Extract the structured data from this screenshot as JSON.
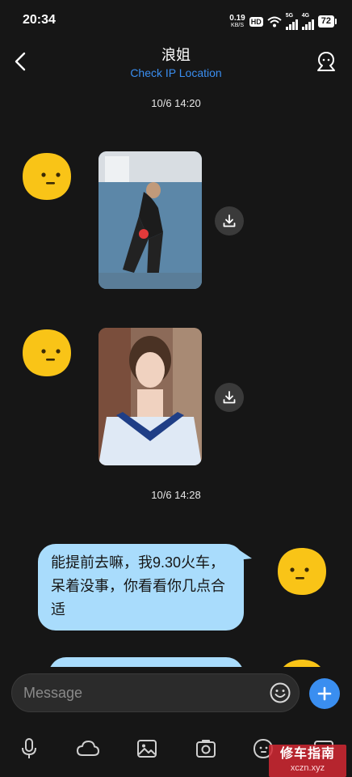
{
  "status": {
    "time": "20:34",
    "net_speed": "0.19",
    "net_unit": "KB/S",
    "hd": "HD",
    "sig1_label": "5G",
    "sig2_label": "4G",
    "battery": "72"
  },
  "header": {
    "title": "浪姐",
    "subtitle": "Check IP Location"
  },
  "messages": {
    "timestamp_1": "10/6 14:20",
    "timestamp_2": "10/6 14:28",
    "outgoing_text": "能提前去嘛，我9.30火车，呆着没事，你看看你几点合适"
  },
  "composer": {
    "placeholder": "Message"
  },
  "watermark": {
    "main": "修车指南",
    "sub": "xczn.xyz"
  },
  "colors": {
    "accent": "#3a8ef0",
    "bubble": "#a9dcfc",
    "avatar": "#f9c417",
    "background": "#161616"
  }
}
